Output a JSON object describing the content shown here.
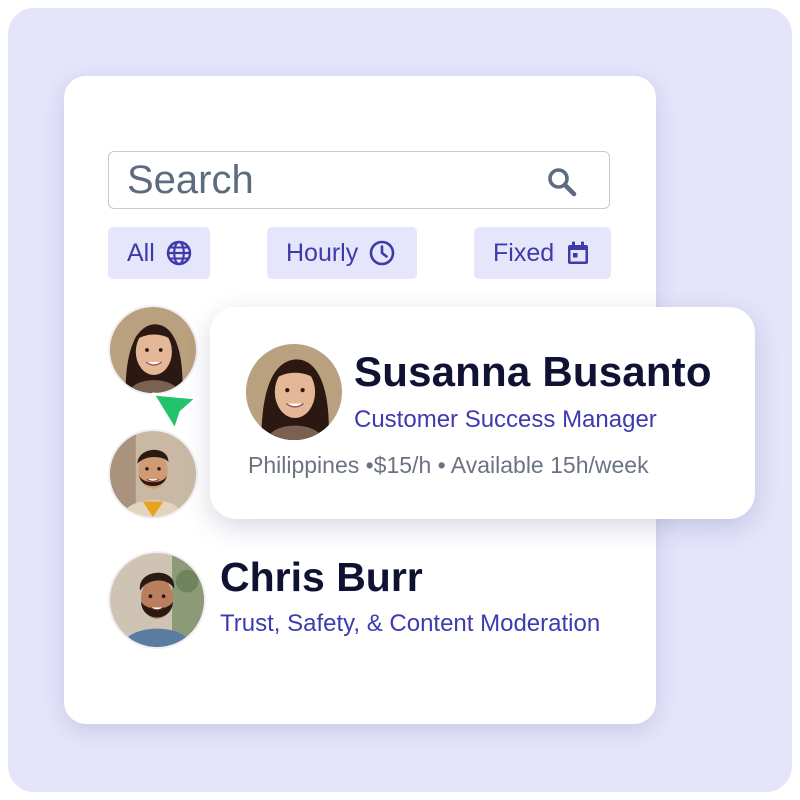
{
  "search": {
    "placeholder": "Search",
    "icon": "search-icon"
  },
  "filters": [
    {
      "label": "All",
      "icon": "globe-icon"
    },
    {
      "label": "Hourly",
      "icon": "clock-icon"
    },
    {
      "label": "Fixed",
      "icon": "calendar-icon"
    }
  ],
  "profile_card": {
    "name": "Susanna Busanto",
    "role": "Customer Success Manager",
    "meta": "Philippines •$15/h • Available 15h/week"
  },
  "list": [
    {
      "avatar": "avatar-woman"
    },
    {
      "avatar": "avatar-man"
    },
    {
      "avatar": "avatar-bearded-man",
      "name": "Chris Burr",
      "role": "Trust, Safety, & Content Moderation"
    }
  ],
  "colors": {
    "background": "#e4e5fb",
    "chip_bg": "#e5e5fb",
    "accent": "#3e3ab0",
    "name_text": "#0f1233",
    "meta_text": "#6b7383",
    "cursor": "#22c36a"
  }
}
